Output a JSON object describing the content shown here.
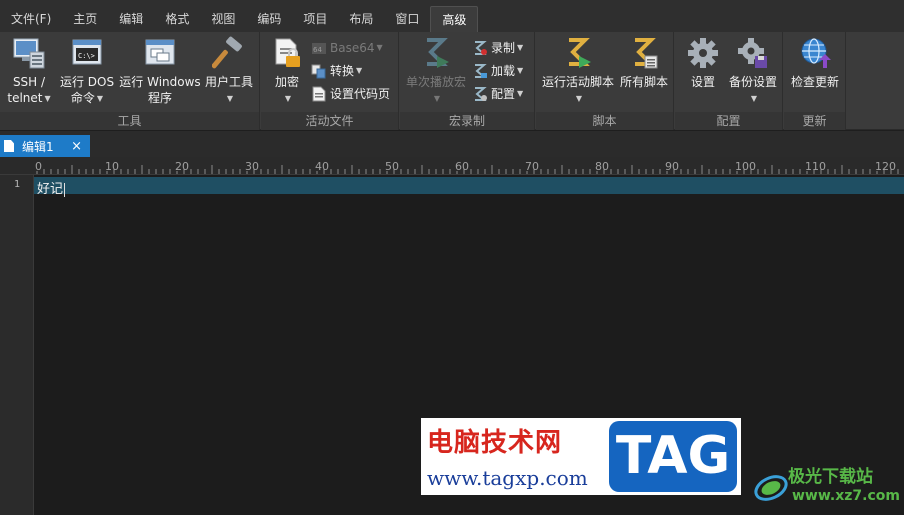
{
  "menu": {
    "items": [
      "文件(F)",
      "主页",
      "编辑",
      "格式",
      "视图",
      "编码",
      "项目",
      "布局",
      "窗口",
      "高级"
    ],
    "active_index": 9
  },
  "ribbon": {
    "tools": {
      "label": "工具",
      "ssh_line1": "SSH /",
      "ssh_line2": "telnet",
      "dos_line1": "运行 DOS",
      "dos_line2": "命令",
      "dos_icon_text": "C:\\>",
      "win_line1": "运行 Windows",
      "win_line2": "程序",
      "user_tools": "用户工具"
    },
    "active_file": {
      "label": "活动文件",
      "encrypt": "加密",
      "base64": "Base64",
      "base64_icon_text": "64",
      "convert": "转换",
      "set_codepage": "设置代码页"
    },
    "macro": {
      "label": "宏录制",
      "play_once": "单次播放宏",
      "record": "录制",
      "load": "加载",
      "config": "配置"
    },
    "script": {
      "label": "脚本",
      "run_active": "运行活动脚本",
      "all_scripts": "所有脚本"
    },
    "config": {
      "label": "配置",
      "settings": "设置",
      "backup_settings": "备份设置"
    },
    "update": {
      "label": "更新",
      "check_update": "检查更新"
    }
  },
  "tab": {
    "title": "编辑1",
    "close": "×"
  },
  "ruler": {
    "labels": [
      "0",
      "10",
      "20",
      "30",
      "40",
      "50",
      "60",
      "70",
      "80",
      "90",
      "100",
      "110",
      "120"
    ]
  },
  "editor": {
    "line_number": "1",
    "line_text": "好记"
  },
  "watermark": {
    "site_title": "电脑技术网",
    "site_url": "www.tagxp.com",
    "tag": "TAG",
    "site2_title": "极光下载站",
    "site2_url": "www.xz7.com"
  },
  "colors": {
    "menubar": "#2f2f2f",
    "ribbon": "#3b3b3b",
    "tab_active": "#1e7bc8",
    "active_line": "#1f4f63",
    "editor_bg": "#1c1c1c"
  }
}
